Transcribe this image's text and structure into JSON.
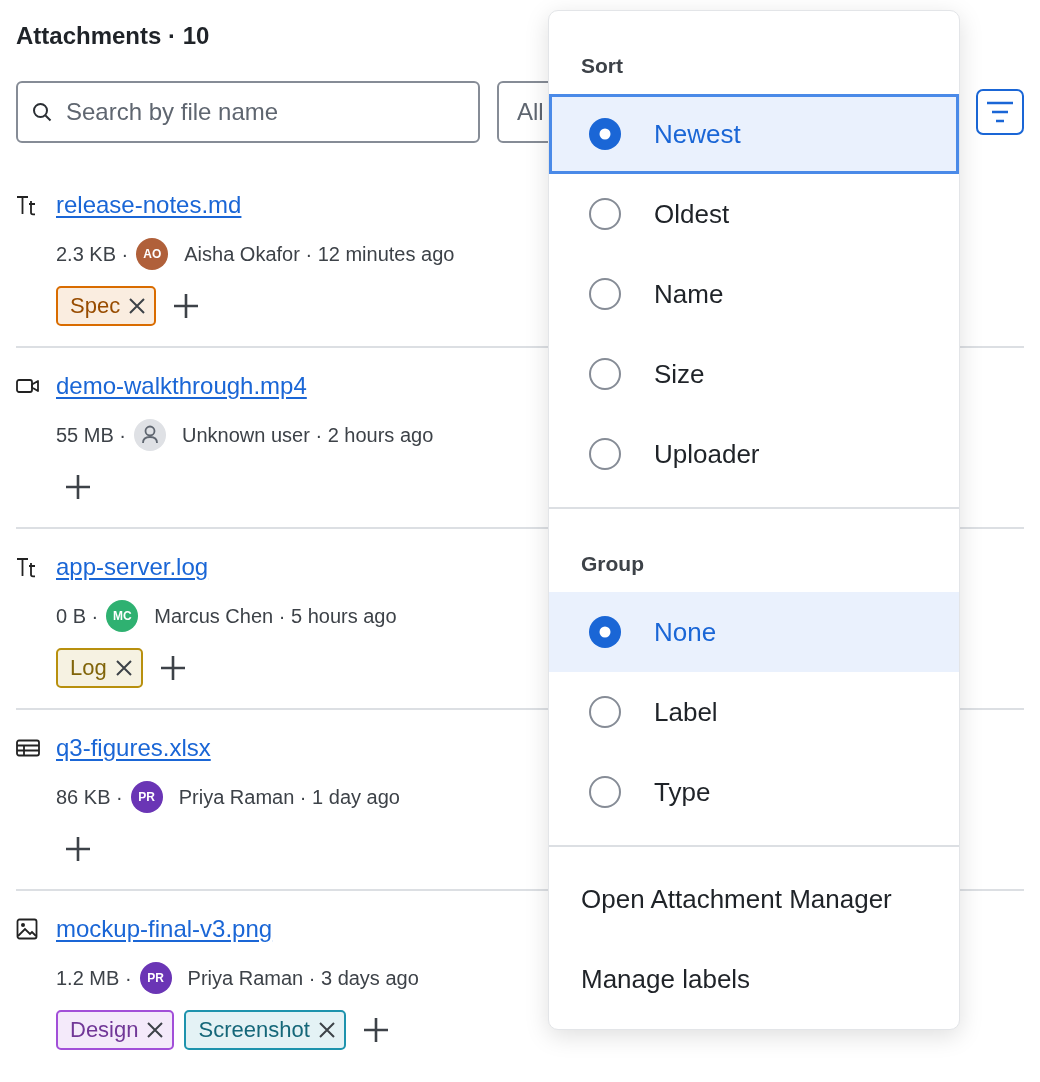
{
  "title": "Attachments · 10",
  "search": {
    "placeholder": "Search by file name"
  },
  "filter_select": {
    "value": "All"
  },
  "attachments": [
    {
      "name": "release-notes.md",
      "kind": "text",
      "size": "2.3 KB ·",
      "uploader": {
        "kind": "user",
        "initials": "AO",
        "color": "#b0603a"
      },
      "detail": "Aisha Okafor · 12 minutes ago",
      "labels": [
        {
          "text": "Spec",
          "color": "#d96c00"
        }
      ]
    },
    {
      "name": "demo-walkthrough.mp4",
      "kind": "video",
      "size": "55 MB ·",
      "uploader": {
        "kind": "unknown"
      },
      "detail": "Unknown user · 2 hours ago"
    },
    {
      "name": "app-server.log",
      "kind": "text",
      "size": "0 B ·",
      "uploader": {
        "kind": "user",
        "initials": "MC",
        "color": "#2fb171"
      },
      "detail": "Marcus Chen · 5 hours ago",
      "labels": [
        {
          "text": "Log",
          "color": "#b8900e"
        }
      ]
    },
    {
      "name": "q3-figures.xlsx",
      "kind": "spreadsheet",
      "size": "86 KB ·",
      "uploader": {
        "kind": "user",
        "initials": "PR",
        "color": "#6a35b5"
      },
      "detail": "Priya Raman · 1 day ago"
    },
    {
      "name": "mockup-final-v3.png",
      "kind": "image",
      "size": "1.2 MB ·",
      "uploader": {
        "kind": "user",
        "initials": "PR",
        "color": "#6a35b5"
      },
      "detail": "Priya Raman · 3 days ago",
      "labels": [
        {
          "text": "Design",
          "color": "#a24fd8"
        },
        {
          "text": "Screenshot",
          "color": "#1e93ad"
        }
      ]
    }
  ],
  "menu": {
    "sections": [
      {
        "heading": "Sort",
        "items": [
          {
            "label": "Newest",
            "selected": true,
            "focused": true
          },
          {
            "label": "Oldest",
            "selected": false,
            "focused": false
          },
          {
            "label": "Name",
            "selected": false,
            "focused": false
          },
          {
            "label": "Size",
            "selected": false,
            "focused": false
          },
          {
            "label": "Uploader",
            "selected": false,
            "focused": false
          }
        ]
      },
      {
        "heading": "Group",
        "items": [
          {
            "label": "None",
            "selected": true,
            "focused": false
          },
          {
            "label": "Label",
            "selected": false,
            "focused": false
          },
          {
            "label": "Type",
            "selected": false,
            "focused": false
          }
        ]
      }
    ],
    "actions": [
      "Open Attachment Manager",
      "Manage labels"
    ]
  }
}
